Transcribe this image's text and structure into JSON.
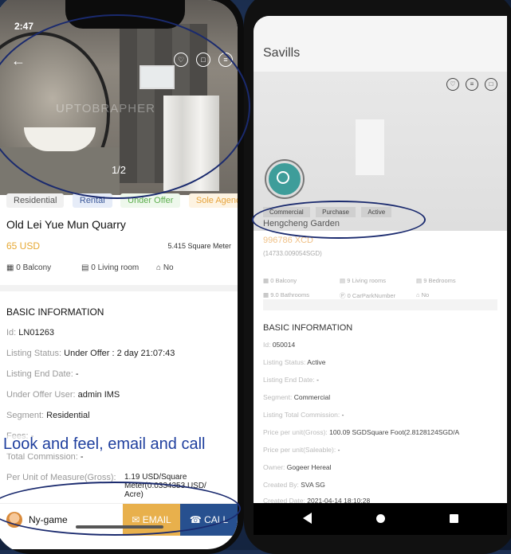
{
  "left_app": {
    "status_time": "2:47",
    "photo": {
      "watermark": "UPTOBRAPHER",
      "pager": "1/2"
    },
    "tags": [
      "Residential",
      "Rental",
      "Under Offer",
      "Sole Agency"
    ],
    "title": "Old Lei Yue Mun Quarry",
    "price": "65 USD",
    "area": "5.415 Square Meter",
    "features": [
      "0 Balcony",
      "0 Living room",
      "No"
    ],
    "section_title": "BASIC INFORMATION",
    "rows": [
      {
        "label": "Id:",
        "value": "LN01263"
      },
      {
        "label": "Listing Status:",
        "value": "Under Offer : 2 day 21:07:43"
      },
      {
        "label": "Listing End Date:",
        "value": "-"
      },
      {
        "label": "Under Offer User:",
        "value": "admin IMS"
      },
      {
        "label": "Segment:",
        "value": "Residential"
      },
      {
        "label": "Fees:",
        "value": "-"
      },
      {
        "label": "Total Commission:",
        "value": "-"
      },
      {
        "label": "Per Unit of Measure(Gross):",
        "value": "1.19 USD/Square Meter(0.0334353 USD/ Acre)"
      }
    ],
    "caption": "Look and feel, email and call",
    "agent_name": "Ny-game",
    "email_label": "EMAIL",
    "call_label": "CALL"
  },
  "right_app": {
    "app_title": "Savills",
    "tags": [
      "Commercial",
      "Purchase",
      "Active"
    ],
    "name": "Hengcheng Garden",
    "price": "996786 XCD",
    "sub_price": "(14733.009054SGD)",
    "features": [
      "0 Balcony",
      "9 Living rooms",
      "9 Bedrooms",
      "9.0 Bathrooms",
      "0 CarParkNumber",
      "No"
    ],
    "section_title": "BASIC INFORMATION",
    "rows": [
      {
        "label": "Id:",
        "value": "050014"
      },
      {
        "label": "Listing Status:",
        "value": "Active"
      },
      {
        "label": "Listing End Date:",
        "value": "-"
      },
      {
        "label": "Segment:",
        "value": "Commercial"
      },
      {
        "label": "Listing Total Commission:",
        "value": "-"
      },
      {
        "label": "Price per unit(Gross):",
        "value": "100.09 SGDSquare Foot(2.8128124SGD/A"
      },
      {
        "label": "Price per unit(Saleable):",
        "value": "-"
      },
      {
        "label": "Owner:",
        "value": "Gogeer Hereal"
      },
      {
        "label": "Created By:",
        "value": "SVA SG"
      },
      {
        "label": "Created Date:",
        "value": "2021-04-14 18:10:28"
      }
    ]
  },
  "colors": {
    "accent_gold": "#e6a833",
    "email_button": "#e8b04c",
    "call_button": "#27508f",
    "annotation_ellipse": "#1a2a6e"
  }
}
